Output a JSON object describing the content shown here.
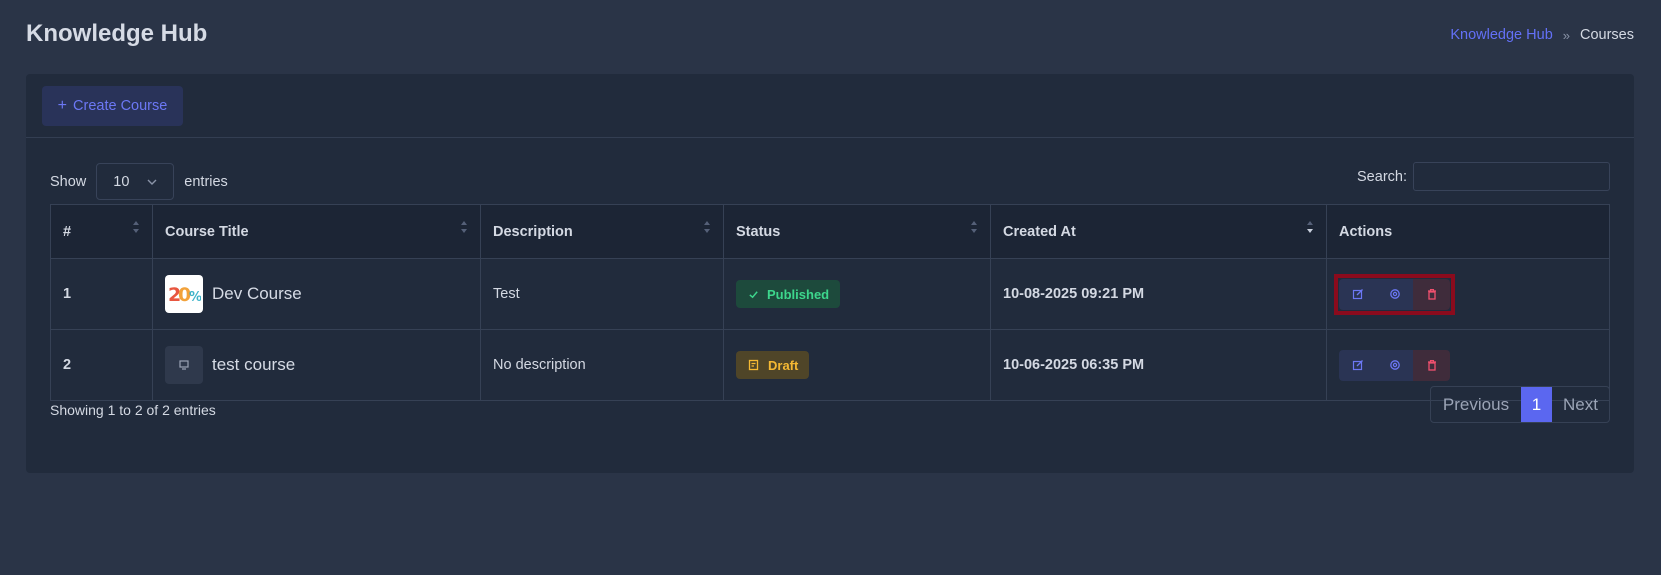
{
  "header": {
    "title": "Knowledge Hub",
    "breadcrumb": {
      "link": "Knowledge Hub",
      "separator": "»",
      "current": "Courses"
    }
  },
  "toolbar": {
    "create_label": "Create Course",
    "create_icon": "plus-icon"
  },
  "length_menu": {
    "prefix": "Show",
    "value": "10",
    "suffix": "entries"
  },
  "search": {
    "label": "Search:",
    "value": ""
  },
  "table": {
    "columns": [
      "#",
      "Course Title",
      "Description",
      "Status",
      "Created At",
      "Actions"
    ],
    "rows": [
      {
        "num": "1",
        "title": "Dev Course",
        "thumb": "course-image",
        "description": "Test",
        "status": "Published",
        "status_icon": "check-icon",
        "created": "10-08-2025 09:21 PM"
      },
      {
        "num": "2",
        "title": "test course",
        "thumb": "placeholder-icon",
        "description": "No description",
        "status": "Draft",
        "status_icon": "edit-note-icon",
        "created": "10-06-2025 06:35 PM"
      }
    ]
  },
  "footer": {
    "info": "Showing 1 to 2 of 2 entries",
    "pagination": {
      "previous": "Previous",
      "current": "1",
      "next": "Next"
    }
  },
  "colors": {
    "background": "#2a3447",
    "card": "#212b3c",
    "accent": "#5b67f0",
    "published": "#3dd68c",
    "draft": "#f5b933",
    "delete": "#f0506e",
    "highlight": "#8b0b1d"
  }
}
